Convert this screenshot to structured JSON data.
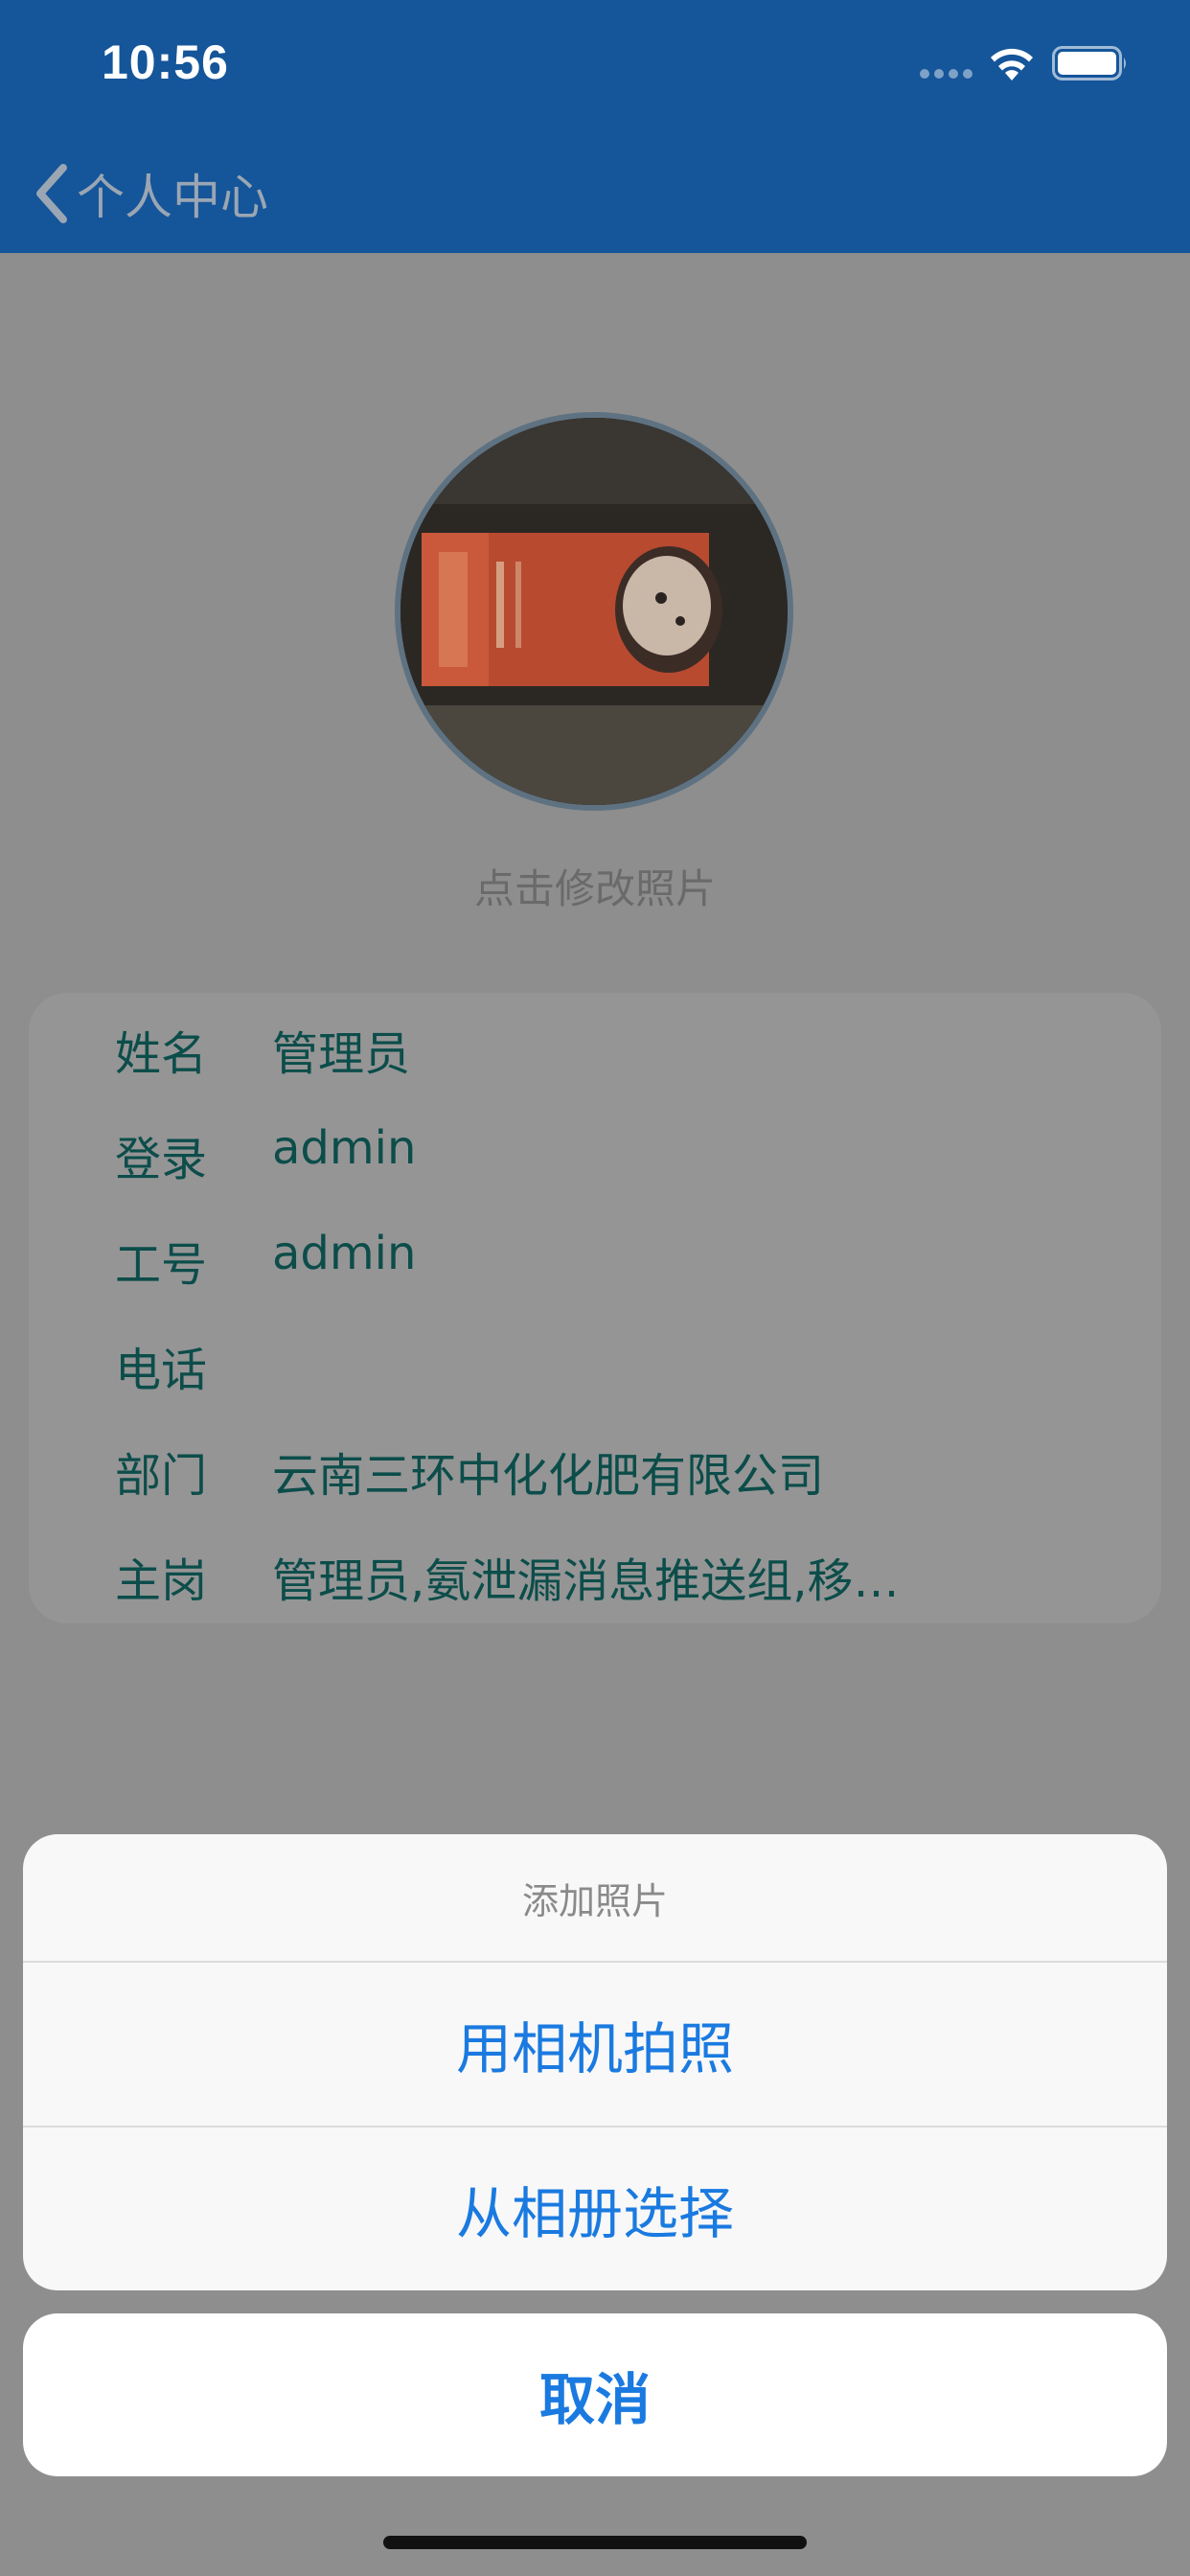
{
  "status_bar": {
    "time": "10:56"
  },
  "nav": {
    "back_label": "个人中心"
  },
  "profile": {
    "change_photo_label": "点击修改照片",
    "fields": [
      {
        "label": "姓名",
        "value": "管理员"
      },
      {
        "label": "登录",
        "value": "admin"
      },
      {
        "label": "工号",
        "value": "admin"
      },
      {
        "label": "电话",
        "value": ""
      },
      {
        "label": "部门",
        "value": "云南三环中化化肥有限公司"
      },
      {
        "label": "主岗",
        "value": "管理员,氨泄漏消息推送组,移…"
      }
    ]
  },
  "action_sheet": {
    "title": "添加照片",
    "options": [
      {
        "label": "用相机拍照"
      },
      {
        "label": "从相册选择"
      }
    ],
    "cancel_label": "取消"
  },
  "colors": {
    "nav_background": "#15559a",
    "accent": "#1a7ae0",
    "info_text": "#0c4d4a"
  }
}
